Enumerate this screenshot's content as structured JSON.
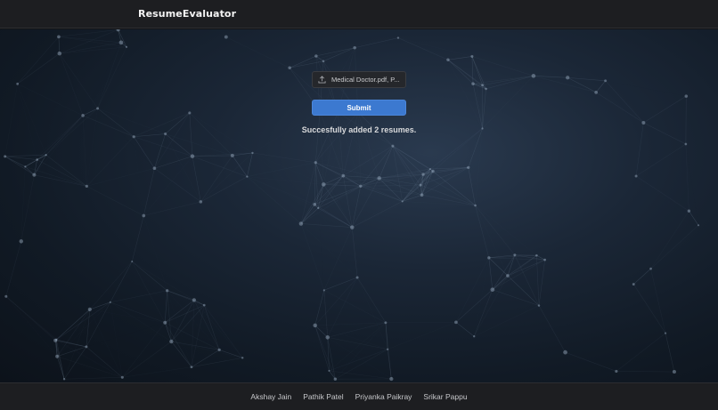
{
  "navbar": {
    "brand": "ResumeEvaluator"
  },
  "upload": {
    "file_label": "Medical Doctor.pdf, P...",
    "icon": "upload-icon",
    "submit_label": "Submit",
    "status_message": "Succesfully added 2 resumes."
  },
  "footer": {
    "links": [
      "Akshay Jain",
      "Pathik Patel",
      "Priyanka Paikray",
      "Srikar Pappu"
    ]
  },
  "colors": {
    "accent": "#3c79d0",
    "header_bg": "#1d1e21",
    "hero_bg": "#111a25"
  }
}
